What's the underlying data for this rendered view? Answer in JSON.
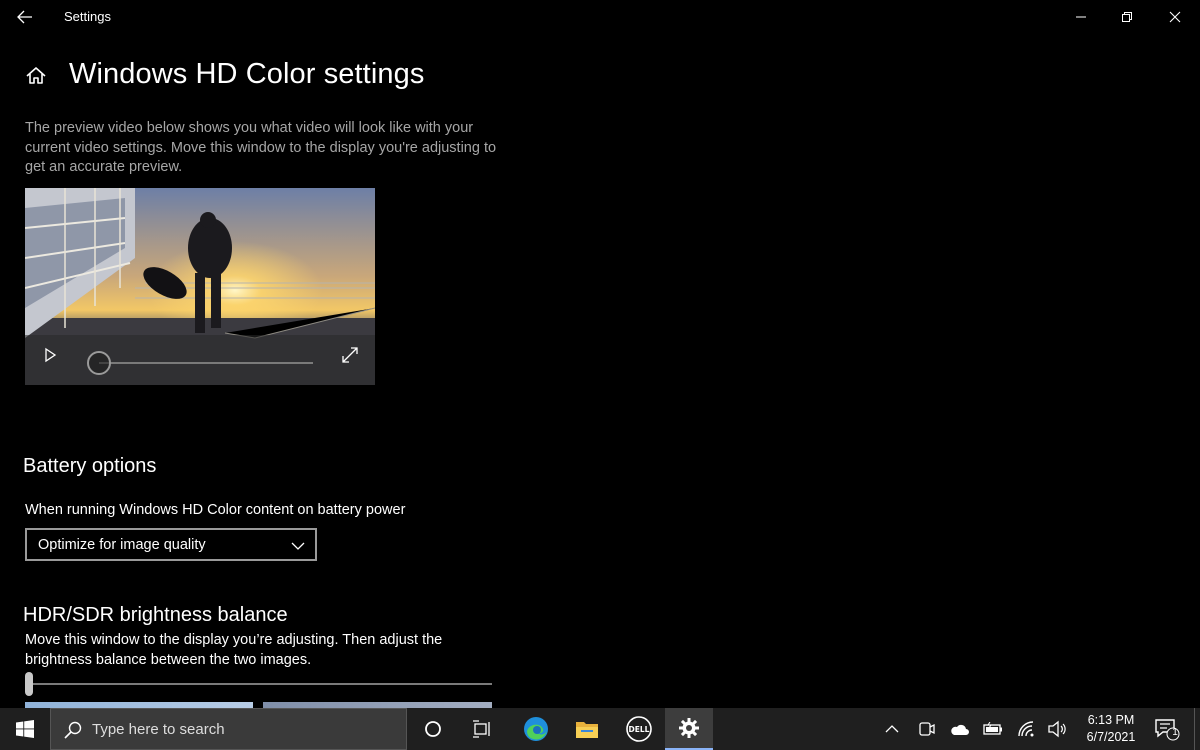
{
  "window": {
    "title": "Settings",
    "controls": [
      "minimize-icon",
      "restore-icon",
      "close-icon"
    ]
  },
  "page": {
    "title": "Windows HD Color settings",
    "description": "The preview video below shows you what video will look like with your current video settings. Move this window to the display you're adjusting to get an accurate preview."
  },
  "video": {
    "progress": 0.0,
    "icons": [
      "play-icon",
      "expand-icon"
    ]
  },
  "battery": {
    "heading": "Battery options",
    "label": "When running Windows HD Color content on battery power",
    "selected_option": "Optimize for image quality"
  },
  "hdr_sdr": {
    "heading": "HDR/SDR brightness balance",
    "description": "Move this window to the display you’re adjusting. Then adjust the brightness balance between the two images.",
    "slider_value": 0.0
  },
  "taskbar": {
    "search_placeholder": "Type here to search",
    "apps": [
      "cortana-icon",
      "task-view-icon",
      "edge-icon",
      "file-explorer-icon",
      "dell-icon",
      "settings-icon"
    ],
    "active_app": "settings-icon",
    "clock": {
      "time": "6:13 PM",
      "date": "6/7/2021"
    },
    "notification_count": "1"
  },
  "colors": {
    "background": "#000000",
    "taskbar": "#1f1f1f",
    "description_text": "#a6a6a6"
  }
}
